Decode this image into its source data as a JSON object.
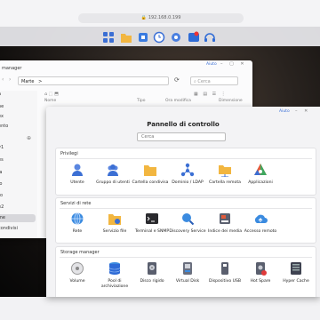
{
  "browser": {
    "url": "192.168.0.199"
  },
  "taskbar": {
    "icons": [
      "apps-grid-icon",
      "file-station-icon",
      "package-icon",
      "clock-icon",
      "settings-icon",
      "photos-icon",
      "support-icon"
    ]
  },
  "file_station": {
    "title": "manager",
    "help": "Aiuto",
    "path": "Marte",
    "path_arrow": ">",
    "search_placeholder": "Cerca",
    "sidebar": [
      "a",
      "ne",
      "ex",
      "ento",
      "",
      "y1",
      "es",
      "ia",
      "lo",
      "to",
      "e2",
      "me",
      "condivisi"
    ],
    "columns": {
      "name": "Nome",
      "type": "Tipo",
      "modified": "Ora modifica",
      "size": "Dimensione"
    }
  },
  "control_panel": {
    "help": "Aiuto",
    "title": "Pannello di controllo",
    "search_placeholder": "Cerca",
    "sections": [
      {
        "title": "Privilegi",
        "items": [
          {
            "label": "Utente",
            "icon": "user-icon"
          },
          {
            "label": "Gruppo di utenti",
            "icon": "user-group-icon"
          },
          {
            "label": "Cartella condivisa",
            "icon": "shared-folder-icon"
          },
          {
            "label": "Dominio / LDAP",
            "icon": "domain-ldap-icon"
          },
          {
            "label": "Cartella remota",
            "icon": "remote-folder-icon"
          },
          {
            "label": "Applicazioni",
            "icon": "applications-icon"
          }
        ]
      },
      {
        "title": "Servizi di rete",
        "items": [
          {
            "label": "Rete",
            "icon": "network-icon"
          },
          {
            "label": "Servizio file",
            "icon": "file-service-icon"
          },
          {
            "label": "Terminal e SNMP",
            "icon": "terminal-icon"
          },
          {
            "label": "Discovery Service",
            "icon": "discovery-icon"
          },
          {
            "label": "Indice dei media",
            "icon": "media-index-icon"
          },
          {
            "label": "Accesso remoto",
            "icon": "remote-access-icon"
          }
        ]
      },
      {
        "title": "Storage manager",
        "items": [
          {
            "label": "Volume",
            "icon": "volume-icon"
          },
          {
            "label": "Pool di archiviazione",
            "icon": "storage-pool-icon"
          },
          {
            "label": "Disco rigido",
            "icon": "hard-disk-icon"
          },
          {
            "label": "Virtual Disk",
            "icon": "virtual-disk-icon"
          },
          {
            "label": "Dispositivo USB",
            "icon": "usb-device-icon"
          },
          {
            "label": "Hot Spare",
            "icon": "hot-spare-icon"
          },
          {
            "label": "Hyper Cache",
            "icon": "hyper-cache-icon"
          }
        ]
      }
    ]
  }
}
